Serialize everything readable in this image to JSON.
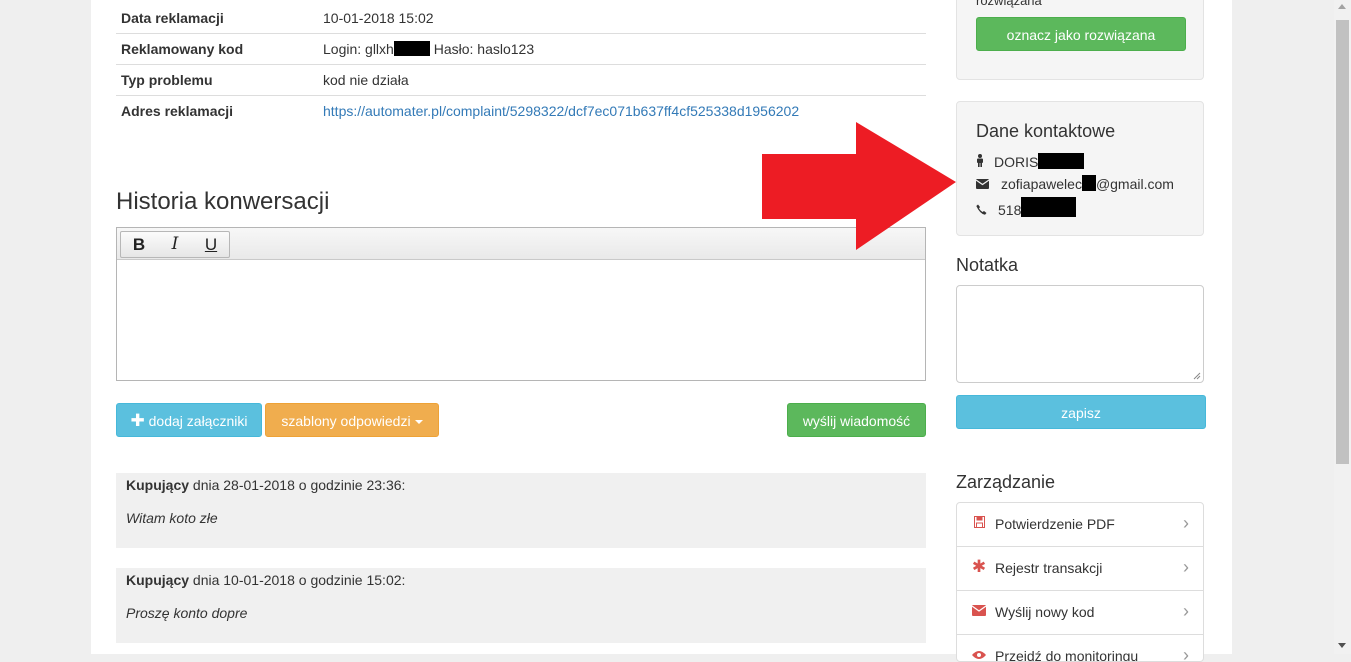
{
  "details": {
    "rows": [
      {
        "label": "Data reklamacji",
        "value": "10-01-2018 15:02"
      },
      {
        "label": "Reklamowany kod",
        "value_prefix": "Login: gllxh",
        "value_suffix": "Hasło: haslo123"
      },
      {
        "label": "Typ problemu",
        "value": "kod nie działa"
      },
      {
        "label": "Adres reklamacji",
        "link": "https://automater.pl/complaint/5298322/dcf7ec071b637ff4cf525338d1956202"
      }
    ]
  },
  "conversation": {
    "title": "Historia konwersacji",
    "toolbar": {
      "bold": "B",
      "italic": "I",
      "underline": "U"
    },
    "buttons": {
      "attach": "dodaj załączniki",
      "templates": "szablony odpowiedzi",
      "send": "wyślij wiadomość"
    },
    "messages": [
      {
        "author": "Kupujący",
        "meta": "dnia 28-01-2018 o godzinie 23:36:",
        "text": "Witam koto złe"
      },
      {
        "author": "Kupujący",
        "meta": "dnia 10-01-2018 o godzinie 15:02:",
        "text": "Proszę konto dopre"
      }
    ]
  },
  "sidebar": {
    "resolved_label": "rozwiązana",
    "mark_resolved_button": "oznacz jako rozwiązana",
    "contact": {
      "title": "Dane kontaktowe",
      "name": "DORIS",
      "email_prefix": "zofiapawelec",
      "email_suffix": "@gmail.com",
      "phone": "518"
    },
    "note": {
      "title": "Notatka",
      "save_button": "zapisz"
    },
    "management": {
      "title": "Zarządzanie",
      "items": [
        {
          "label": "Potwierdzenie PDF",
          "icon": "file-pdf-icon"
        },
        {
          "label": "Rejestr transakcji",
          "icon": "asterisk-icon"
        },
        {
          "label": "Wyślij nowy kod",
          "icon": "envelope-icon"
        },
        {
          "label": "Przejdź do monitoringu",
          "icon": "eye-icon"
        }
      ]
    }
  },
  "colors": {
    "info": "#5bc0de",
    "warning": "#f0ad4e",
    "success": "#5cb85c",
    "link": "#337ab7",
    "annotation_arrow": "#ed1c24"
  }
}
